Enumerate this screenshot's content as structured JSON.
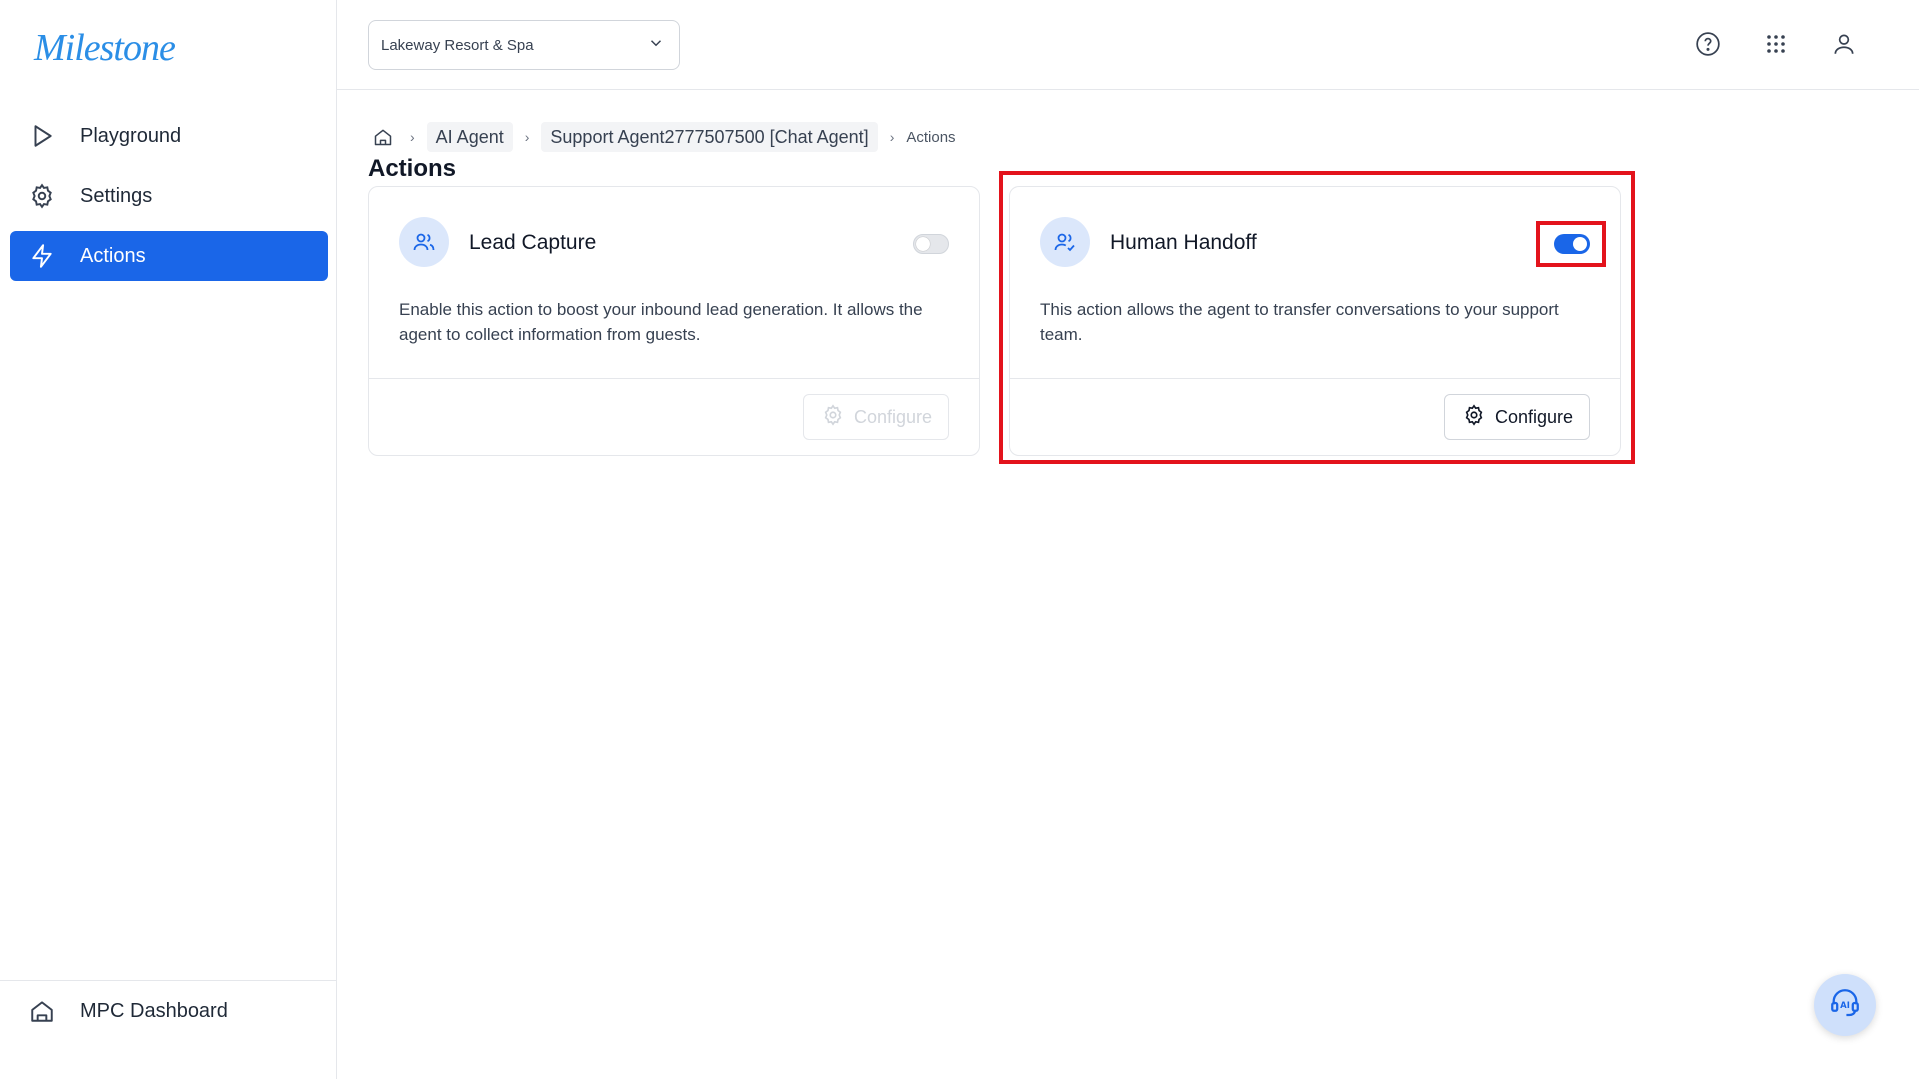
{
  "brand": {
    "logo_text": "Milestone",
    "color": "#2b8ee6"
  },
  "sidebar": {
    "items": [
      {
        "label": "Playground",
        "icon": "play-icon"
      },
      {
        "label": "Settings",
        "icon": "gear-icon"
      },
      {
        "label": "Actions",
        "icon": "lightning-icon",
        "active": true
      }
    ],
    "bottom_item": {
      "label": "MPC Dashboard",
      "icon": "home-icon"
    }
  },
  "header": {
    "property_select": {
      "value": "Lakeway Resort & Spa"
    },
    "icons": [
      "help-icon",
      "apps-grid-icon",
      "user-icon"
    ]
  },
  "breadcrumb": {
    "items": [
      "AI Agent",
      "Support Agent2777507500 [Chat Agent]"
    ],
    "current": "Actions"
  },
  "page": {
    "title": "Actions"
  },
  "cards": [
    {
      "title": "Lead Capture",
      "description": "Enable this action to boost your inbound lead generation. It allows the agent to collect information from guests.",
      "enabled": false,
      "configure_label": "Configure",
      "icon": "users-icon"
    },
    {
      "title": "Human Handoff",
      "description": "This action allows the agent to transfer conversations to your support team.",
      "enabled": true,
      "configure_label": "Configure",
      "icon": "user-check-icon"
    }
  ],
  "colors": {
    "accent": "#1a66e8",
    "highlight": "#e3131c"
  }
}
